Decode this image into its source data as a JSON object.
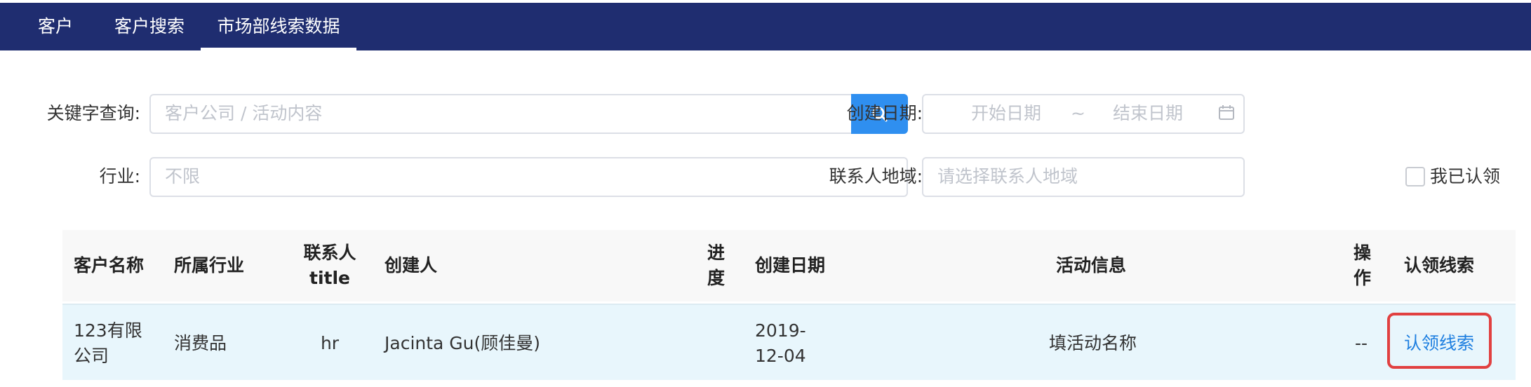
{
  "tabs": [
    "客户",
    "客户搜索",
    "市场部线索数据"
  ],
  "filters": {
    "keyword_label": "关键字查询:",
    "keyword_placeholder": "客户公司 / 活动内容",
    "date_label": "创建日期:",
    "date_start": "开始日期",
    "date_sep": "~",
    "date_end": "结束日期",
    "industry_label": "行业:",
    "industry_value": "不限",
    "region_label": "联系人地域:",
    "region_placeholder": "请选择联系人地域",
    "claimed_label": "我已认领"
  },
  "table": {
    "headers": {
      "name": "客户名称",
      "industry": "所属行业",
      "title_top": "联系人",
      "title_bottom": "title",
      "creator": "创建人",
      "progress_top": "进",
      "progress_bottom": "度",
      "date": "创建日期",
      "activity": "活动信息",
      "op_top": "操",
      "op_bottom": "作",
      "claim": "认领线索"
    },
    "rows": [
      {
        "name_line1": "123有限",
        "name_line2": "公司",
        "industry": "消费品",
        "title": "hr",
        "creator": "Jacinta Gu(顾佳曼)",
        "progress": "",
        "date_line1": "2019-",
        "date_line2": "12-04",
        "activity": "填活动名称",
        "op": "--",
        "claim": "认领线索"
      }
    ]
  },
  "colors": {
    "nav_bg": "#1f2d70",
    "primary": "#2f8ff0",
    "row_highlight": "#e8f6fc",
    "link": "#1e7fe0",
    "annotation": "#e14040"
  }
}
